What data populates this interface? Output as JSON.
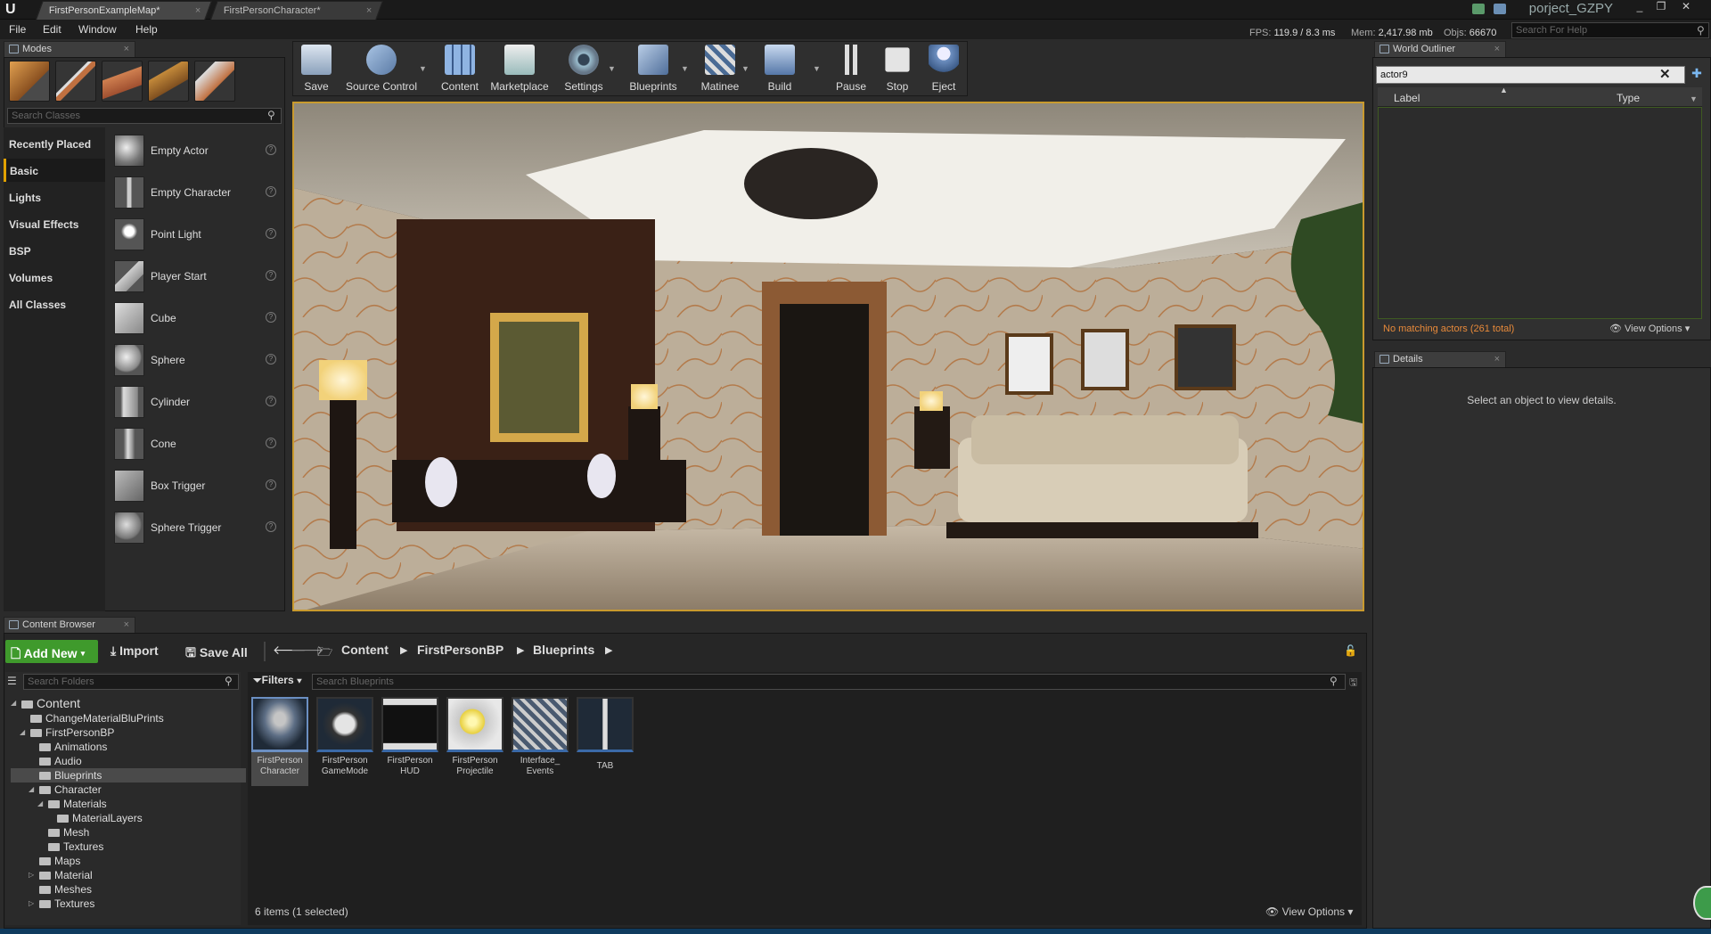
{
  "titlebar": {
    "tabs": [
      "FirstPersonExampleMap*",
      "FirstPersonCharacter*"
    ],
    "project": "porject_GZPY"
  },
  "menu": [
    "File",
    "Edit",
    "Window",
    "Help"
  ],
  "stats": {
    "fps_label": "FPS:",
    "fps": "119.9 / 8.3 ms",
    "mem_label": "Mem:",
    "mem": "2,417.98 mb",
    "objs_label": "Objs:",
    "objs": "66670"
  },
  "help_search": {
    "placeholder": "Search For Help"
  },
  "modes": {
    "title": "Modes",
    "search_placeholder": "Search Classes",
    "categories": [
      "Recently Placed",
      "Basic",
      "Lights",
      "Visual Effects",
      "BSP",
      "Volumes",
      "All Classes"
    ],
    "selected_category": "Basic",
    "items": [
      "Empty Actor",
      "Empty Character",
      "Point Light",
      "Player Start",
      "Cube",
      "Sphere",
      "Cylinder",
      "Cone",
      "Box Trigger",
      "Sphere Trigger"
    ]
  },
  "toolbar": {
    "buttons": [
      "Save",
      "Source Control",
      "Content",
      "Marketplace",
      "Settings",
      "Blueprints",
      "Matinee",
      "Build",
      "Pause",
      "Stop",
      "Eject"
    ]
  },
  "outliner": {
    "title": "World Outliner",
    "search_value": "actor9",
    "col_label": "Label",
    "col_type": "Type",
    "status": "No matching actors (261 total)",
    "view_options": "View Options"
  },
  "details": {
    "title": "Details",
    "message": "Select an object to view details."
  },
  "content_browser": {
    "title": "Content Browser",
    "add_new": "Add New",
    "import": "Import",
    "save_all": "Save All",
    "breadcrumb": [
      "Content",
      "FirstPersonBP",
      "Blueprints"
    ],
    "search_folders": "Search Folders",
    "filters": "Filters",
    "search_assets": "Search Blueprints",
    "tree": [
      {
        "label": "Content",
        "depth": 0,
        "arrow": "◢"
      },
      {
        "label": "ChangeMaterialBluPrints",
        "depth": 1,
        "arrow": ""
      },
      {
        "label": "FirstPersonBP",
        "depth": 1,
        "arrow": "◢"
      },
      {
        "label": "Animations",
        "depth": 2,
        "arrow": ""
      },
      {
        "label": "Audio",
        "depth": 2,
        "arrow": ""
      },
      {
        "label": "Blueprints",
        "depth": 2,
        "arrow": "",
        "selected": true
      },
      {
        "label": "Character",
        "depth": 2,
        "arrow": "◢"
      },
      {
        "label": "Materials",
        "depth": 3,
        "arrow": "◢"
      },
      {
        "label": "MaterialLayers",
        "depth": 4,
        "arrow": ""
      },
      {
        "label": "Mesh",
        "depth": 3,
        "arrow": ""
      },
      {
        "label": "Textures",
        "depth": 3,
        "arrow": ""
      },
      {
        "label": "Maps",
        "depth": 2,
        "arrow": ""
      },
      {
        "label": "Material",
        "depth": 2,
        "arrow": "▷"
      },
      {
        "label": "Meshes",
        "depth": 2,
        "arrow": ""
      },
      {
        "label": "Textures",
        "depth": 2,
        "arrow": "▷"
      }
    ],
    "assets": [
      {
        "line1": "FirstPerson",
        "line2": "Character"
      },
      {
        "line1": "FirstPerson",
        "line2": "GameMode"
      },
      {
        "line1": "FirstPerson",
        "line2": "HUD"
      },
      {
        "line1": "FirstPerson",
        "line2": "Projectile"
      },
      {
        "line1": "Interface_",
        "line2": "Events"
      },
      {
        "line1": "TAB",
        "line2": ""
      }
    ],
    "status": "6 items (1 selected)",
    "view_options": "View Options"
  },
  "colors": {
    "accent": "#c99a2e",
    "add_new": "#3f9a2c",
    "selection": "#3b6aa8"
  }
}
